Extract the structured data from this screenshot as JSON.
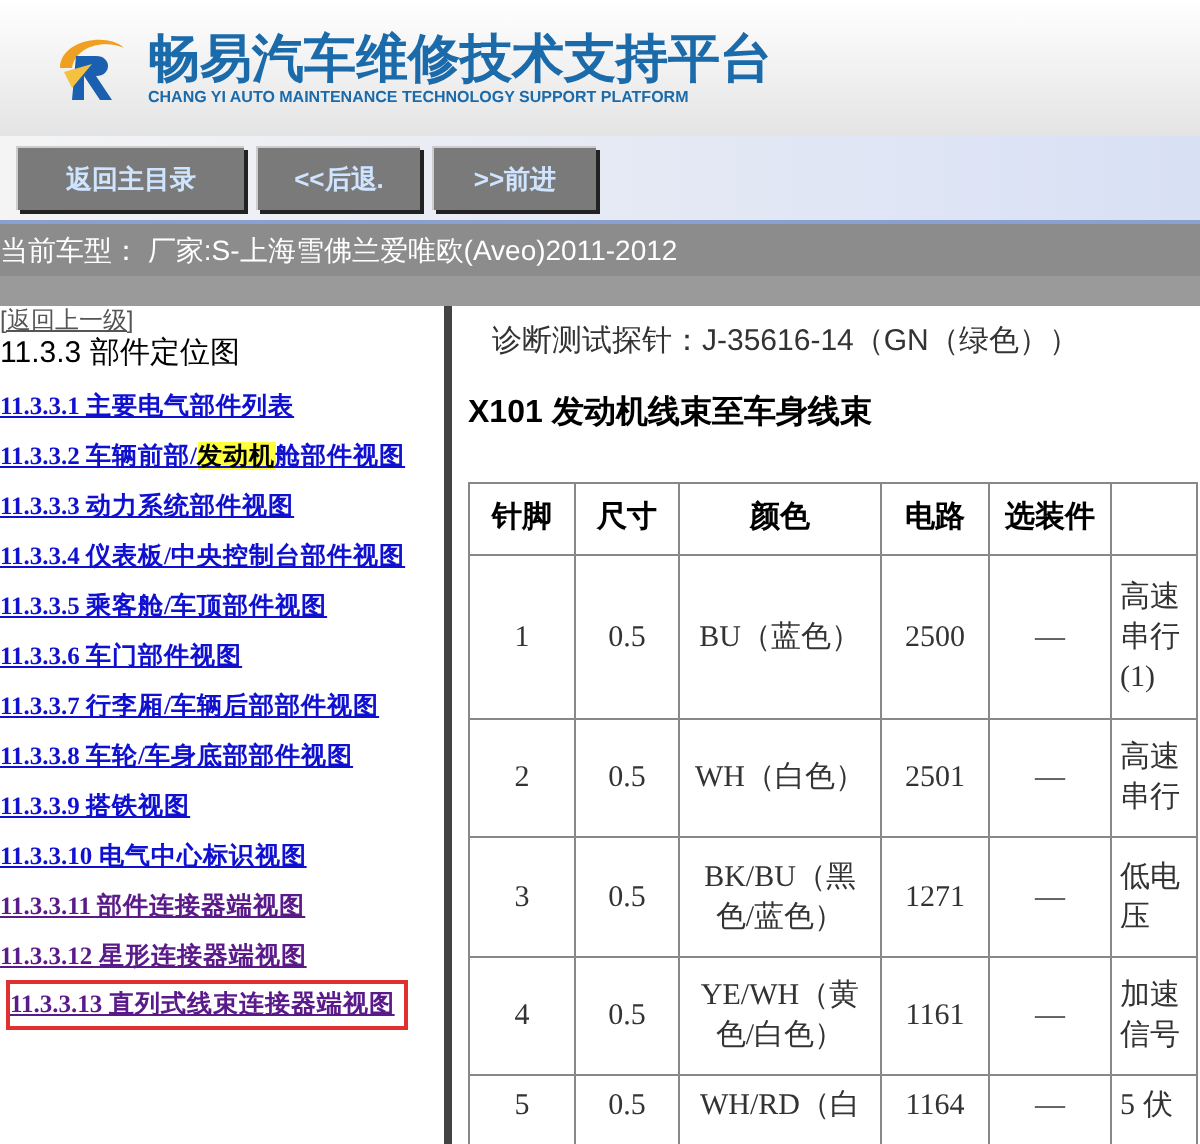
{
  "header": {
    "title": "畅易汽车维修技术支持平台",
    "subtitle": "CHANG YI AUTO MAINTENANCE TECHNOLOGY SUPPORT PLATFORM"
  },
  "nav_buttons": [
    "返回主目录",
    "<<后退.",
    ">>前进"
  ],
  "current_model": "当前车型：  厂家:S-上海雪佛兰爱唯欧(Aveo)2011-2012",
  "sidebar": {
    "back_link": "[返回上一级]",
    "heading": "11.3.3 部件定位图",
    "items": [
      {
        "text": "11.3.3.1 主要电气部件列表",
        "visited": false,
        "outlined": false
      },
      {
        "text": "11.3.3.2 车辆前部/",
        "highlight": "发动机",
        "text_after": "舱部件视图",
        "visited": false,
        "outlined": false
      },
      {
        "text": "11.3.3.3 动力系统部件视图",
        "visited": false,
        "outlined": false
      },
      {
        "text": "11.3.3.4 仪表板/中央控制台部件视图",
        "visited": false,
        "outlined": false
      },
      {
        "text": "11.3.3.5 乘客舱/车顶部件视图",
        "visited": false,
        "outlined": false
      },
      {
        "text": "11.3.3.6 车门部件视图",
        "visited": false,
        "outlined": false
      },
      {
        "text": "11.3.3.7 行李厢/车辆后部部件视图",
        "visited": false,
        "outlined": false
      },
      {
        "text": "11.3.3.8 车轮/车身底部部件视图",
        "visited": false,
        "outlined": false
      },
      {
        "text": "11.3.3.9 搭铁视图",
        "visited": false,
        "outlined": false
      },
      {
        "text": "11.3.3.10 电气中心标识视图",
        "visited": false,
        "outlined": false
      },
      {
        "text": "11.3.3.11 部件连接器端视图",
        "visited": true,
        "outlined": false
      },
      {
        "text": "11.3.3.12 星形连接器端视图",
        "visited": true,
        "outlined": false
      },
      {
        "text": "11.3.3.13 直列式线束连接器端视图",
        "visited": true,
        "outlined": true
      }
    ]
  },
  "content": {
    "probe_line": "诊断测试探针：J-35616-14（GN（绿色））",
    "connector_title": "X101 发动机线束至车身线束",
    "table": {
      "columns": [
        "针脚",
        "尺寸",
        "颜色",
        "电路",
        "选装件"
      ],
      "rows": [
        [
          "1",
          "0.5",
          "BU（蓝色）",
          "2500",
          "—",
          "高速串行(1)"
        ],
        [
          "2",
          "0.5",
          "WH（白色）",
          "2501",
          "—",
          "高速串行"
        ],
        [
          "3",
          "0.5",
          "BK/BU（黑色/蓝色）",
          "1271",
          "—",
          "低电压"
        ],
        [
          "4",
          "0.5",
          "YE/WH（黄色/白色）",
          "1161",
          "—",
          "加速信号"
        ],
        [
          "5",
          "0.5",
          "WH/RD（白",
          "1164",
          "—",
          "5 伏"
        ]
      ]
    }
  }
}
